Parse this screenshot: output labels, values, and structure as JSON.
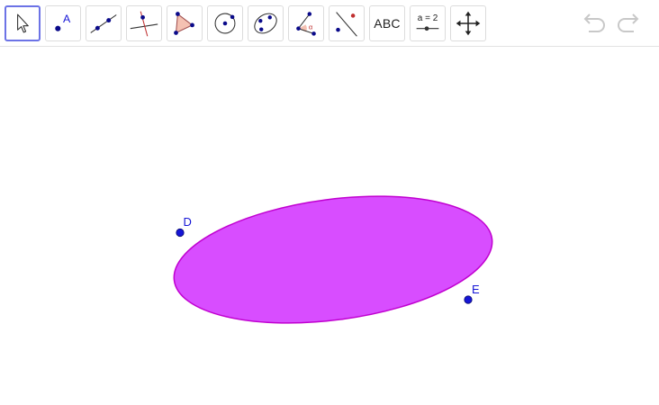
{
  "toolbar": {
    "tools": [
      {
        "name": "move-tool",
        "icon": "cursor-arrow-icon",
        "active": true
      },
      {
        "name": "point-tool",
        "icon": "point-icon",
        "text": "A"
      },
      {
        "name": "line-tool",
        "icon": "line-through-two-points-icon"
      },
      {
        "name": "perpendicular-line-tool",
        "icon": "perpendicular-line-icon"
      },
      {
        "name": "polygon-tool",
        "icon": "polygon-icon"
      },
      {
        "name": "circle-tool",
        "icon": "circle-center-point-icon"
      },
      {
        "name": "ellipse-tool",
        "icon": "ellipse-icon"
      },
      {
        "name": "angle-tool",
        "icon": "angle-icon",
        "text": "α"
      },
      {
        "name": "reflect-tool",
        "icon": "reflect-about-line-icon"
      },
      {
        "name": "text-tool",
        "icon": "text-icon",
        "text": "ABC"
      },
      {
        "name": "slider-tool",
        "icon": "slider-icon",
        "text": "a = 2"
      },
      {
        "name": "move-graphics-view-tool",
        "icon": "move-arrows-icon"
      }
    ],
    "undo": {
      "icon": "undo-icon"
    },
    "redo": {
      "icon": "redo-icon"
    }
  },
  "canvas": {
    "points": [
      {
        "label": "D",
        "color": "#1515d6"
      },
      {
        "label": "E",
        "color": "#1515d6"
      }
    ],
    "ellipse": {
      "fill": "#d84dff",
      "stroke": "#c000d0"
    }
  },
  "colors": {
    "accent": "#6c73e6",
    "point": "#1515d6",
    "ellipse_fill": "#d84dff",
    "ellipse_stroke": "#c000d0",
    "icon_blue": "#0a0a8a",
    "icon_red": "#c03030",
    "icon_polygon_fill": "#f4c1b2"
  }
}
